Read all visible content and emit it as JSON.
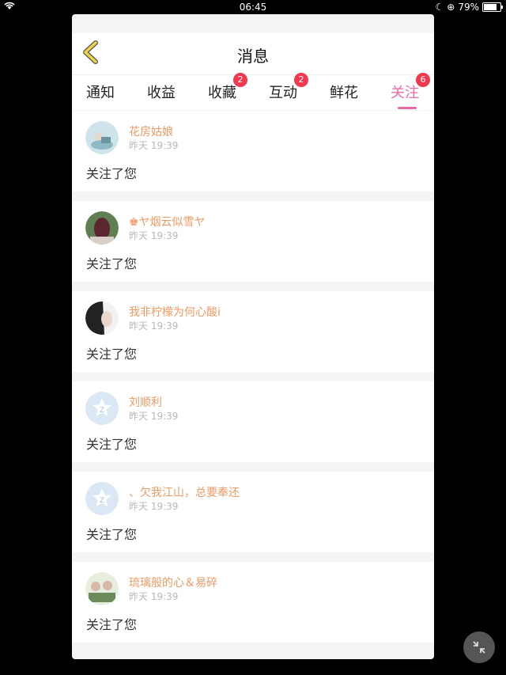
{
  "status": {
    "time": "06:45",
    "battery": "79%",
    "battery_level": 0.79
  },
  "header": {
    "title": "消息"
  },
  "tabs": [
    {
      "label": "通知",
      "badge": null
    },
    {
      "label": "收益",
      "badge": null
    },
    {
      "label": "收藏",
      "badge": "2"
    },
    {
      "label": "互动",
      "badge": "2"
    },
    {
      "label": "鲜花",
      "badge": null
    },
    {
      "label": "关注",
      "badge": "6",
      "active": true
    }
  ],
  "items": [
    {
      "name": "花房姑娘",
      "time": "昨天 19:39",
      "message": "关注了您",
      "avatar": "photo-avatar"
    },
    {
      "name": "♚ヤ烟云似雪ヤ",
      "time": "昨天 19:39",
      "message": "关注了您",
      "avatar": "photo-avatar"
    },
    {
      "name": "我非柠檬为何心酸i",
      "time": "昨天 19:39",
      "message": "关注了您",
      "avatar": "photo-avatar"
    },
    {
      "name": "刘顺利",
      "time": "昨天 19:39",
      "message": "关注了您",
      "avatar": "default-star-avatar"
    },
    {
      "name": "、欠我江山，总要奉还",
      "time": "昨天 19:39",
      "message": "关注了您",
      "avatar": "default-star-avatar"
    },
    {
      "name": "琉璃般的心＆易碎",
      "time": "昨天 19:39",
      "message": "关注了您",
      "avatar": "photo-avatar"
    }
  ],
  "colors": {
    "accent": "#e76aa5",
    "name": "#ef9a64",
    "badge": "#f0384f",
    "back_arrow": "#f1d34a"
  }
}
